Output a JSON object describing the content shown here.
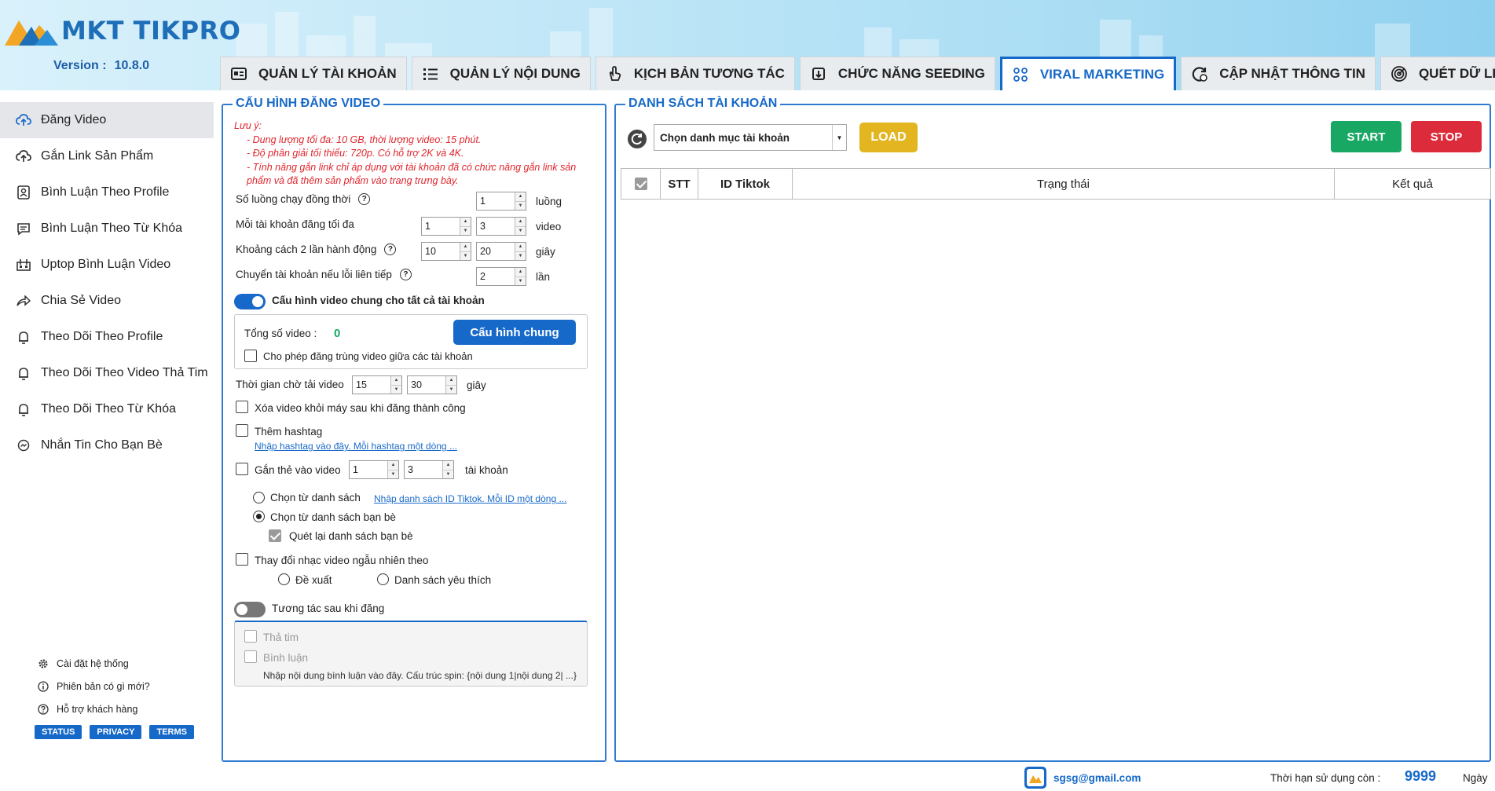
{
  "app": {
    "name": "MKT TIKPRO",
    "version_label": "Version :",
    "version": "10.8.0"
  },
  "tabs": [
    {
      "label": "QUẢN LÝ TÀI KHOẢN",
      "icon": "id-card-icon"
    },
    {
      "label": "QUẢN LÝ NỘI DUNG",
      "icon": "list-icon"
    },
    {
      "label": "KỊCH BẢN TƯƠNG TÁC",
      "icon": "hand-pointer-icon"
    },
    {
      "label": "CHỨC NĂNG SEEDING",
      "icon": "seeding-icon"
    },
    {
      "label": "VIRAL MARKETING",
      "icon": "network-icon",
      "active": true
    },
    {
      "label": "CẬP NHẬT THÔNG TIN",
      "icon": "refresh-info-icon"
    },
    {
      "label": "QUÉT DỮ LIỆU",
      "icon": "radar-icon"
    }
  ],
  "sidebar": {
    "items": [
      {
        "label": "Đăng Video",
        "icon": "cloud-upload-icon",
        "active": true
      },
      {
        "label": "Gắn Link Sản Phẩm",
        "icon": "cloud-link-icon"
      },
      {
        "label": "Bình Luận Theo Profile",
        "icon": "profile-icon"
      },
      {
        "label": "Bình Luận Theo Từ Khóa",
        "icon": "comment-icon"
      },
      {
        "label": "Uptop Bình Luận Video",
        "icon": "uptop-icon"
      },
      {
        "label": "Chia Sẻ Video",
        "icon": "share-icon"
      },
      {
        "label": "Theo Dõi Theo Profile",
        "icon": "bell-icon"
      },
      {
        "label": "Theo Dõi Theo Video Thả Tim",
        "icon": "bell-icon"
      },
      {
        "label": "Theo Dõi Theo Từ Khóa",
        "icon": "bell-icon"
      },
      {
        "label": "Nhắn Tin Cho Bạn Bè",
        "icon": "messenger-icon"
      }
    ],
    "footer_links": [
      {
        "label": "Cài đặt hệ thống",
        "icon": "gear-icon"
      },
      {
        "label": "Phiên bản có gì mới?",
        "icon": "info-icon"
      },
      {
        "label": "Hỗ trợ khách hàng",
        "icon": "help-icon"
      }
    ],
    "badges": [
      "STATUS",
      "PRIVACY",
      "TERMS"
    ]
  },
  "config": {
    "title": "CẤU HÌNH ĐĂNG VIDEO",
    "note_title": "Lưu ý:",
    "notes": [
      "- Dung lượng tối đa: 10 GB, thời lượng video: 15 phút.",
      "- Độ phân giải tối thiểu: 720p. Có hỗ trợ 2K và 4K.",
      "- Tính năng gắn link chỉ áp dụng với tài khoản đã có chức năng gắn link sản phẩm và đã thêm sản phẩm vào trang trưng bày."
    ],
    "threads_label": "Số luồng chạy đồng thời",
    "threads_value": "1",
    "threads_unit": "luồng",
    "max_post_label": "Mỗi tài khoản đăng tối đa",
    "max_post_min": "1",
    "max_post_max": "3",
    "max_post_unit": "video",
    "interval_label": "Khoảng cách 2 lần hành động",
    "interval_min": "10",
    "interval_max": "20",
    "interval_unit": "giây",
    "switch_label": "Chuyển tài khoản nếu lỗi liên tiếp",
    "switch_value": "2",
    "switch_unit": "lần",
    "common_toggle_label": "Cấu hình video chung cho tất cả tài khoản",
    "total_video_label": "Tổng số video :",
    "total_video_value": "0",
    "common_button": "Cấu hình chung",
    "allow_duplicate_label": "Cho phép đăng trùng video giữa các tài khoản",
    "wait_label": "Thời gian chờ tải video",
    "wait_min": "15",
    "wait_max": "30",
    "wait_unit": "giây",
    "delete_label": "Xóa video khỏi máy sau khi đăng thành công",
    "hashtag_label": "Thêm hashtag",
    "hashtag_link": "Nhập hashtag vào đây. Mỗi hashtag một dòng ...",
    "tag_label": "Gắn thẻ vào video",
    "tag_min": "1",
    "tag_max": "3",
    "tag_unit": "tài khoản",
    "tag_from_list": "Chọn từ danh sách",
    "tag_list_link": "Nhập danh sách ID Tiktok. Mỗi ID một dòng ...",
    "tag_from_friends": "Chọn từ danh sách bạn bè",
    "rescan_friends": "Quét lại danh sách bạn bè",
    "music_label": "Thay đổi nhạc video ngẫu nhiên theo",
    "music_suggest": "Đề xuất",
    "music_favorite": "Danh sách yêu thích",
    "interact_toggle_label": "Tương tác sau khi đăng",
    "like_label": "Thả tim",
    "comment_label": "Bình luận",
    "comment_placeholder": "Nhập nội dung bình luận vào đây. Cấu trúc spin: {nội dung 1|nội dung 2| ...}"
  },
  "accounts": {
    "title": "DANH SÁCH TÀI KHOẢN",
    "category_select": "Chọn danh mục tài khoản",
    "load_button": "LOAD",
    "start_button": "START",
    "stop_button": "STOP",
    "columns": [
      "STT",
      "ID Tiktok",
      "Trạng thái",
      "Kết quả"
    ]
  },
  "footer": {
    "email": "sgsg@gmail.com",
    "expiry_label": "Thời hạn sử dụng còn :",
    "expiry_value": "9999",
    "expiry_unit": "Ngày"
  },
  "colors": {
    "accent": "#1769c9",
    "start": "#18a863",
    "stop": "#dc2b3b",
    "load": "#e3b521",
    "note": "#e0262d"
  }
}
